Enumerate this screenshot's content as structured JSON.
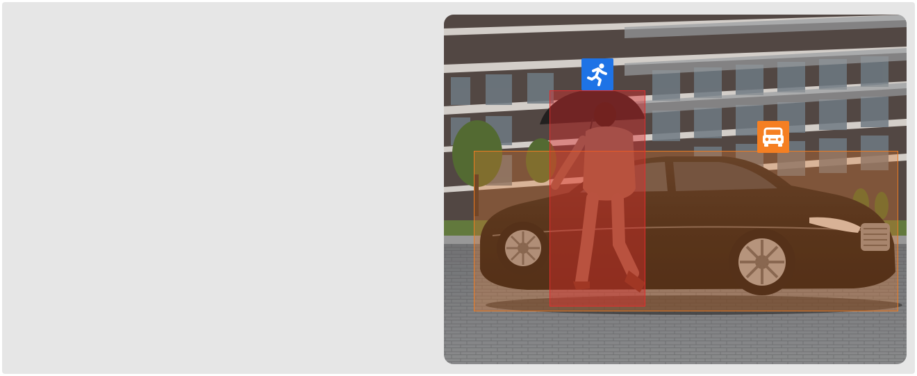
{
  "detection_view": {
    "detections": [
      {
        "class": "person",
        "icon": "running-person-icon",
        "color": "#1e73e6",
        "box_color": "#e02a2a"
      },
      {
        "class": "vehicle",
        "icon": "car-front-icon",
        "color": "#f57f22",
        "box_color": "#e87628"
      }
    ]
  }
}
